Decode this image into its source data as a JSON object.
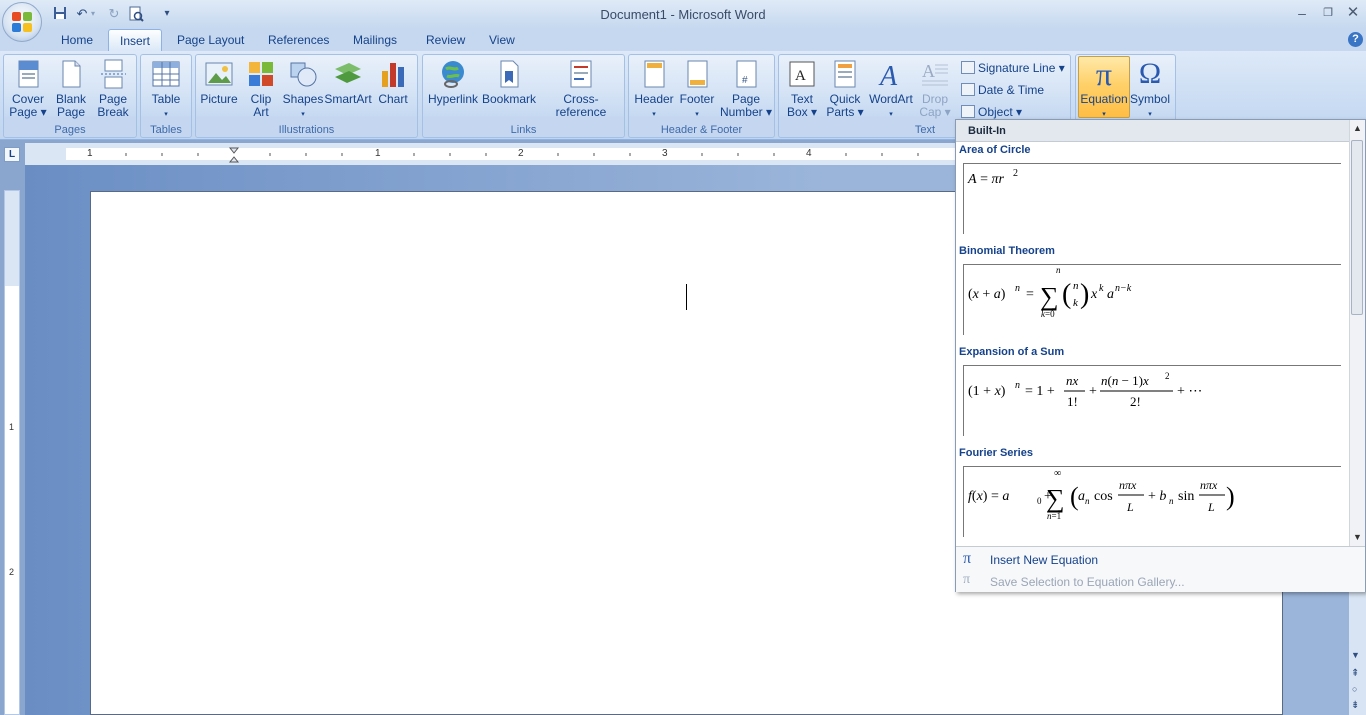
{
  "window": {
    "title": "Document1 - Microsoft Word",
    "help": "?"
  },
  "quick_access": {
    "dropdown_glyph": "▾"
  },
  "tabs": [
    "Home",
    "Insert",
    "Page Layout",
    "References",
    "Mailings",
    "Review",
    "View"
  ],
  "active_tab": "Insert",
  "ribbon": {
    "groups": {
      "pages": "Pages",
      "tables": "Tables",
      "illustrations": "Illustrations",
      "links": "Links",
      "header_footer": "Header & Footer",
      "text": "Text"
    },
    "cover_page": [
      "Cover",
      "Page ▾"
    ],
    "blank_page": [
      "Blank",
      "Page"
    ],
    "page_break": [
      "Page",
      "Break"
    ],
    "table": [
      "Table",
      "▾"
    ],
    "picture": "Picture",
    "clip_art": [
      "Clip",
      "Art"
    ],
    "shapes": [
      "Shapes",
      "▾"
    ],
    "smartart": "SmartArt",
    "chart": "Chart",
    "hyperlink": "Hyperlink",
    "bookmark": "Bookmark",
    "cross_reference": "Cross-reference",
    "header": [
      "Header",
      "▾"
    ],
    "footer": [
      "Footer",
      "▾"
    ],
    "page_number": [
      "Page",
      "Number ▾"
    ],
    "text_box": [
      "Text",
      "Box ▾"
    ],
    "quick_parts": [
      "Quick",
      "Parts ▾"
    ],
    "wordart": [
      "WordArt",
      "▾"
    ],
    "drop_cap": [
      "Drop",
      "Cap ▾"
    ],
    "signature_line": "Signature Line ▾",
    "date_time": "Date & Time",
    "object": "Object ▾",
    "equation": [
      "Equation",
      "▾"
    ],
    "symbol": [
      "Symbol",
      "▾"
    ]
  },
  "ruler": {
    "labels": [
      "1",
      "1",
      "2",
      "3",
      "4"
    ]
  },
  "vruler": {
    "labels": [
      "1",
      "2"
    ]
  },
  "gallery": {
    "header": "Built-In",
    "items": [
      {
        "name": "Area of Circle"
      },
      {
        "name": "Binomial Theorem"
      },
      {
        "name": "Expansion of a Sum"
      },
      {
        "name": "Fourier Series"
      }
    ],
    "insert_new": "Insert New Equation",
    "save_selection": "Save Selection to Equation Gallery..."
  },
  "colors": {
    "ribbon_text": "#15428b",
    "accent_active": "#ffd16a"
  }
}
